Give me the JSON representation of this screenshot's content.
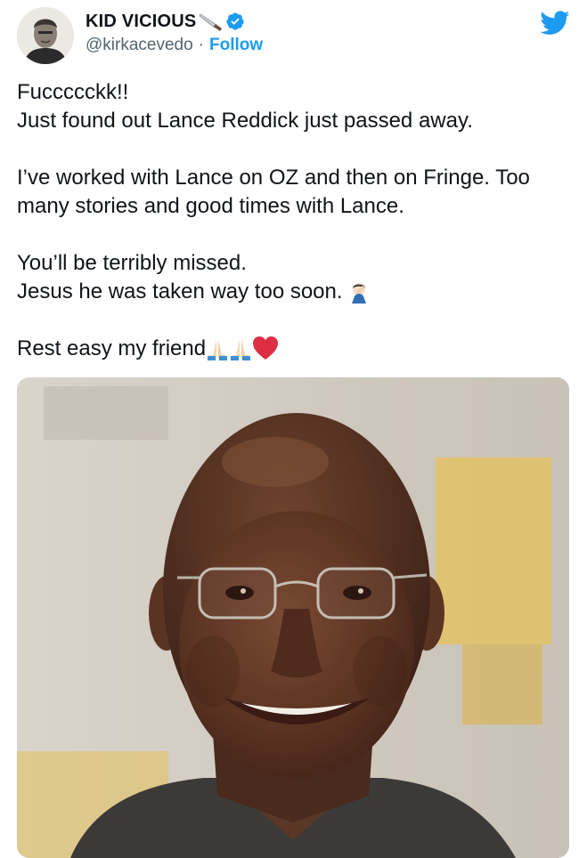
{
  "author": {
    "display_name": "KID VICIOUS",
    "handle": "@kirkacevedo",
    "separator": "·",
    "follow_label": "Follow"
  },
  "icons": {
    "avatar": "avatar-photo",
    "knife": "knife-emoji",
    "verified": "verified-badge-icon",
    "twitter": "twitter-bird-icon",
    "facepalm": "man-facepalming-emoji",
    "pray": "folded-hands-emoji",
    "heart": "red-heart-emoji"
  },
  "colors": {
    "twitter_blue": "#1d9bf0",
    "text": "#0f1419",
    "secondary": "#536471",
    "heart_red": "#dd2e44"
  },
  "tweet": {
    "line1": "Fuccccckk!!",
    "line2": "Just found out Lance Reddick just passed away.",
    "line3": "I’ve worked with Lance on OZ and then on Fringe. Too",
    "line4": "many stories and good times with Lance.",
    "line5": "You’ll be terribly missed.",
    "line6": "Jesus he was taken way too soon.",
    "line7": "Rest easy my friend"
  },
  "media": {
    "type": "photo"
  }
}
